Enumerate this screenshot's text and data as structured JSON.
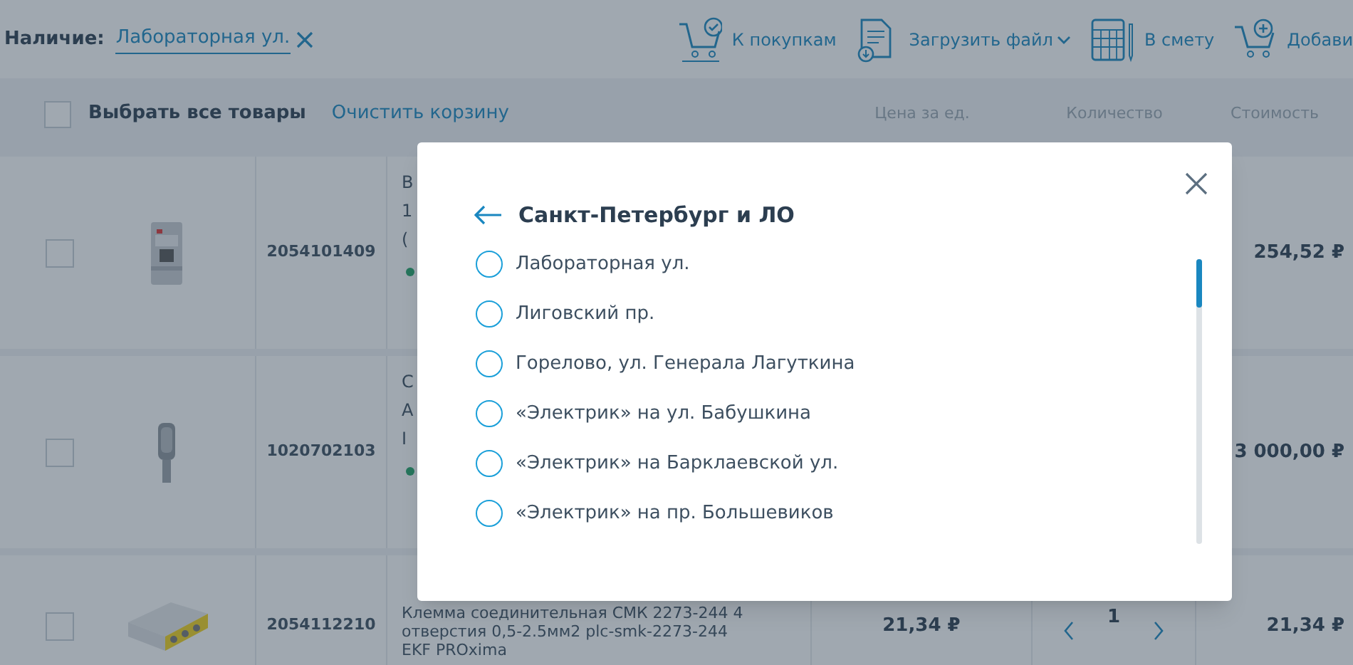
{
  "availability": {
    "label": "Наличие:",
    "value": "Лабораторная ул."
  },
  "toolbar": [
    {
      "kind": "cart-check",
      "label": "К покупкам",
      "dropdown": false
    },
    {
      "kind": "file",
      "label": "Загрузить файл",
      "dropdown": true
    },
    {
      "kind": "calculator",
      "label": "В смету",
      "dropdown": false
    },
    {
      "kind": "cart-plus",
      "label": "Добави",
      "dropdown": false
    }
  ],
  "cart_header": {
    "select_all": {
      "label": "Выбрать все товары",
      "checked": false
    },
    "clear": "Очистить корзину",
    "columns": [
      "Цена за ед.",
      "Количество",
      "Стоимость"
    ]
  },
  "rows": [
    {
      "checked": false,
      "code": "2054101409",
      "name_lines": [
        "В",
        "1",
        "("
      ],
      "in_stock": true,
      "total": "254,52 ₽"
    },
    {
      "checked": false,
      "code": "1020702103",
      "name_lines": [
        "С",
        "А",
        "I"
      ],
      "in_stock": true,
      "total": "3 000,00 ₽"
    },
    {
      "checked": false,
      "code": "2054112210",
      "name_lines": [
        "Клемма соединительная СМК 2273-244 4",
        "отверстия 0,5-2.5мм2 plc-smk-2273-244",
        "EKF PROxima"
      ],
      "in_stock": false,
      "price": "21,34 ₽",
      "quantity": "1",
      "total": "21,34 ₽"
    }
  ],
  "modal": {
    "title": "Санкт-Петербург и ЛО",
    "options": [
      {
        "label": "Лабораторная ул.",
        "selected": false
      },
      {
        "label": "Лиговский пр.",
        "selected": false
      },
      {
        "label": "Горелово, ул. Генерала Лагуткина",
        "selected": false
      },
      {
        "label": "«Электрик» на ул. Бабушкина",
        "selected": false
      },
      {
        "label": "«Электрик» на Барклаевской ул.",
        "selected": false
      },
      {
        "label": "«Электрик» на пр. Большевиков",
        "selected": false
      }
    ]
  }
}
